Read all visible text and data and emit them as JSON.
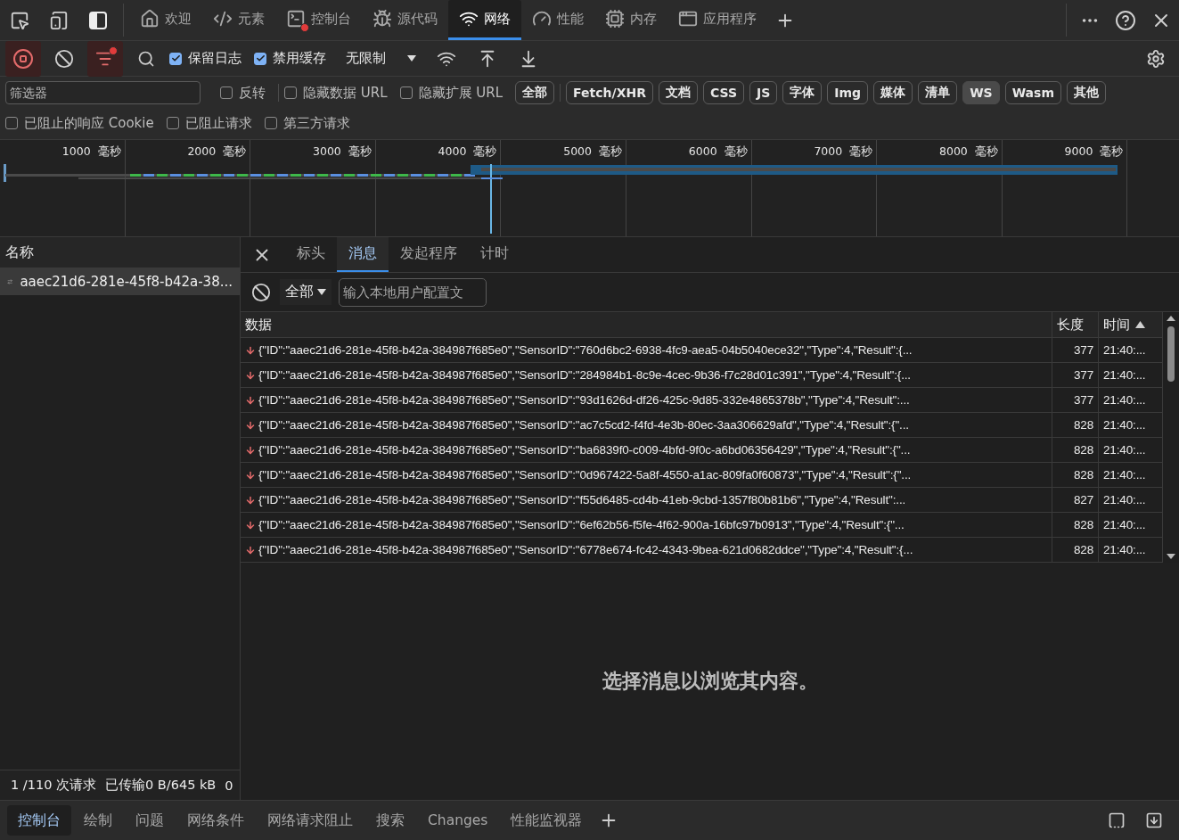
{
  "main_tabs": [
    {
      "label": "欢迎",
      "selected": false,
      "error_badge": false
    },
    {
      "label": "元素",
      "selected": false,
      "error_badge": false
    },
    {
      "label": "控制台",
      "selected": false,
      "error_badge": true
    },
    {
      "label": "源代码",
      "selected": false,
      "error_badge": false
    },
    {
      "label": "网络",
      "selected": true,
      "error_badge": false
    },
    {
      "label": "性能",
      "selected": false,
      "error_badge": false
    },
    {
      "label": "内存",
      "selected": false,
      "error_badge": false
    },
    {
      "label": "应用程序",
      "selected": false,
      "error_badge": false
    }
  ],
  "toolbar": {
    "recording": true,
    "checkboxes": [
      {
        "label": "保留日志",
        "checked": true
      },
      {
        "label": "禁用缓存",
        "checked": true
      }
    ],
    "throttling": "无限制"
  },
  "filter": {
    "placeholder": "筛选器",
    "checkboxes": [
      {
        "label": "反转",
        "checked": false
      },
      {
        "label": "隐藏数据 URL",
        "checked": false
      },
      {
        "label": "隐藏扩展 URL",
        "checked": false
      }
    ],
    "types": [
      {
        "label": "全部",
        "selected": false
      },
      {
        "label": "Fetch/XHR",
        "selected": false
      },
      {
        "label": "文档",
        "selected": false
      },
      {
        "label": "CSS",
        "selected": false
      },
      {
        "label": "JS",
        "selected": false
      },
      {
        "label": "字体",
        "selected": false
      },
      {
        "label": "Img",
        "selected": false
      },
      {
        "label": "媒体",
        "selected": false
      },
      {
        "label": "清单",
        "selected": false
      },
      {
        "label": "WS",
        "selected": true
      },
      {
        "label": "Wasm",
        "selected": false
      },
      {
        "label": "其他",
        "selected": false
      }
    ],
    "more_checkboxes": [
      {
        "label": "已阻止的响应 Cookie",
        "checked": false
      },
      {
        "label": "已阻止请求",
        "checked": false
      },
      {
        "label": "第三方请求",
        "checked": false
      }
    ]
  },
  "timeline": {
    "ticks": [
      "1000  毫秒",
      "2000  毫秒",
      "3000  毫秒",
      "4000  毫秒",
      "5000  毫秒",
      "6000  毫秒",
      "7000  毫秒",
      "8000  毫秒",
      "9000  毫秒"
    ]
  },
  "requests": {
    "header": "名称",
    "items": [
      {
        "name": "aaec21d6-281e-45f8-b42a-38...",
        "selected": true
      }
    ]
  },
  "detail": {
    "tabs": [
      {
        "label": "标头",
        "selected": false
      },
      {
        "label": "消息",
        "selected": true
      },
      {
        "label": "发起程序",
        "selected": false
      },
      {
        "label": "计时",
        "selected": false
      }
    ],
    "message_filter": "全部",
    "search_placeholder": "输入本地用户配置文",
    "columns": [
      {
        "label": "数据",
        "sorted": false
      },
      {
        "label": "长度",
        "sorted": false
      },
      {
        "label": "时间",
        "sorted": true
      }
    ],
    "rows": [
      [
        "{\"ID\":\"aaec21d6-281e-45f8-b42a-384987f685e0\",\"SensorID\":\"760d6bc2-6938-4fc9-aea5-04b5040ece32\",\"Type\":4,\"Result\":{...",
        "377",
        "21:40:..."
      ],
      [
        "{\"ID\":\"aaec21d6-281e-45f8-b42a-384987f685e0\",\"SensorID\":\"284984b1-8c9e-4cec-9b36-f7c28d01c391\",\"Type\":4,\"Result\":{...",
        "377",
        "21:40:..."
      ],
      [
        "{\"ID\":\"aaec21d6-281e-45f8-b42a-384987f685e0\",\"SensorID\":\"93d1626d-df26-425c-9d85-332e4865378b\",\"Type\":4,\"Result\":...",
        "377",
        "21:40:..."
      ],
      [
        "{\"ID\":\"aaec21d6-281e-45f8-b42a-384987f685e0\",\"SensorID\":\"ac7c5cd2-f4fd-4e3b-80ec-3aa306629afd\",\"Type\":4,\"Result\":{\"...",
        "828",
        "21:40:..."
      ],
      [
        "{\"ID\":\"aaec21d6-281e-45f8-b42a-384987f685e0\",\"SensorID\":\"ba6839f0-c009-4bfd-9f0c-a6bd06356429\",\"Type\":4,\"Result\":{\"...",
        "828",
        "21:40:..."
      ],
      [
        "{\"ID\":\"aaec21d6-281e-45f8-b42a-384987f685e0\",\"SensorID\":\"0d967422-5a8f-4550-a1ac-809fa0f60873\",\"Type\":4,\"Result\":{\"...",
        "828",
        "21:40:..."
      ],
      [
        "{\"ID\":\"aaec21d6-281e-45f8-b42a-384987f685e0\",\"SensorID\":\"f55d6485-cd4b-41eb-9cbd-1357f80b81b6\",\"Type\":4,\"Result\":...",
        "827",
        "21:40:..."
      ],
      [
        "{\"ID\":\"aaec21d6-281e-45f8-b42a-384987f685e0\",\"SensorID\":\"6ef62b56-f5fe-4f62-900a-16bfc97b0913\",\"Type\":4,\"Result\":{\"...",
        "828",
        "21:40:..."
      ],
      [
        "{\"ID\":\"aaec21d6-281e-45f8-b42a-384987f685e0\",\"SensorID\":\"6778e674-fc42-4343-9bea-621d0682ddce\",\"Type\":4,\"Result\":{...",
        "828",
        "21:40:..."
      ]
    ],
    "empty_message": "选择消息以浏览其内容。"
  },
  "status_bar": [
    "1 /110 次请求",
    "已传输0 B/645 kB",
    "0"
  ],
  "drawer_tabs": [
    {
      "label": "控制台",
      "selected": true
    },
    {
      "label": "绘制",
      "selected": false
    },
    {
      "label": "问题",
      "selected": false
    },
    {
      "label": "网络条件",
      "selected": false
    },
    {
      "label": "网络请求阻止",
      "selected": false
    },
    {
      "label": "搜索",
      "selected": false
    },
    {
      "label": "Changes",
      "selected": false
    },
    {
      "label": "性能监视器",
      "selected": false
    }
  ]
}
